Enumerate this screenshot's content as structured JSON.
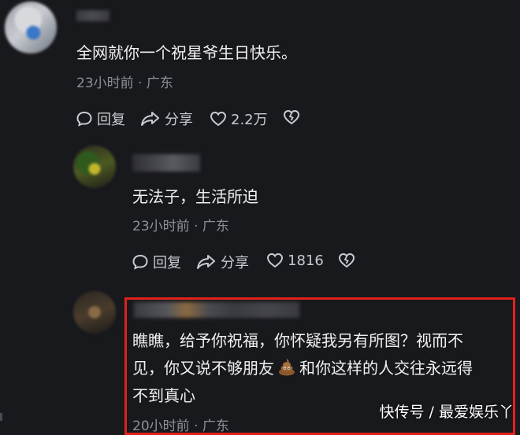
{
  "comments": [
    {
      "text": "全网就你一个祝星爷生日快乐。",
      "meta": "23小时前 · 广东",
      "reply_label": "回复",
      "share_label": "分享",
      "like_count": "2.2万"
    },
    {
      "text": "无法子，生活所迫",
      "meta": "23小时前 · 广东",
      "reply_label": "回复",
      "share_label": "分享",
      "like_count": "1816"
    },
    {
      "text_line1": "瞧瞧，给予你祝福，你怀疑我另有所图？视而不",
      "text_line2a": "见，你又说不够朋友",
      "text_line2b": "和你这样的人交往永远得",
      "text_line3": "不到真心",
      "meta": "20小时前 · 广东",
      "emoji": "poop-emoji"
    }
  ],
  "watermark": "快传号 / 最爱娱乐丫",
  "colors": {
    "background": "#18191d",
    "highlight_border": "#e0221b",
    "meta_text": "#8e8f96"
  }
}
